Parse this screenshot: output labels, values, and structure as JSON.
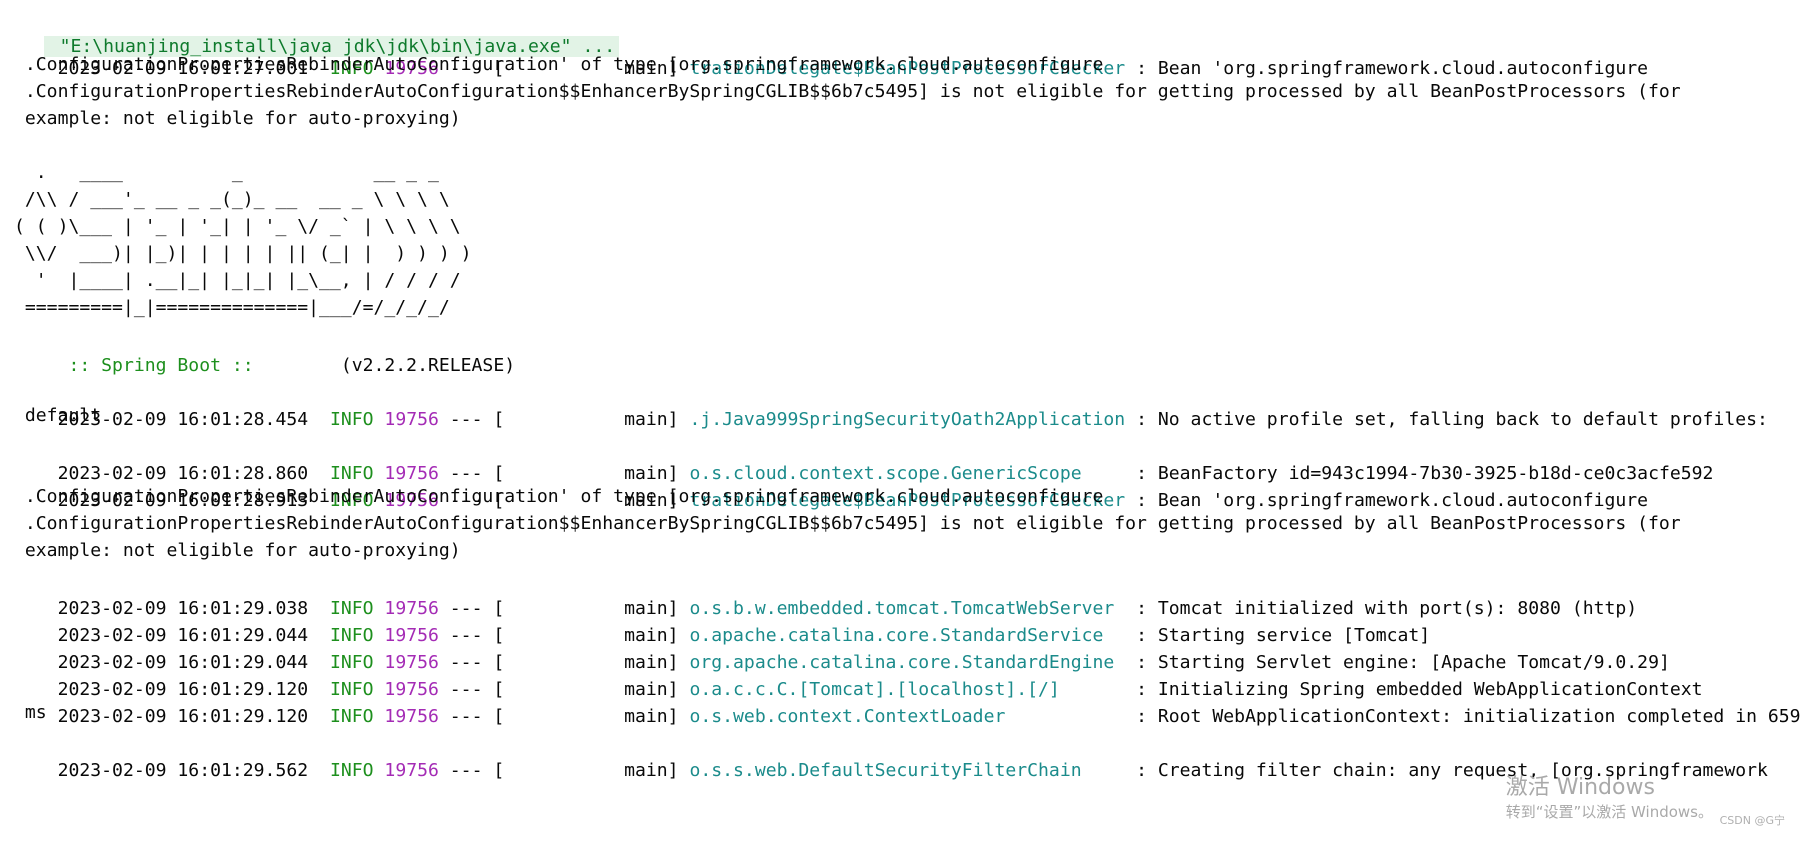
{
  "command": "\"E:\\huanjing_install\\java jdk\\jdk\\bin\\java.exe\" ...",
  "banner": [
    "  .   ____          _            __ _ _",
    " /\\\\ / ___'_ __ _ _(_)_ __  __ _ \\ \\ \\ \\",
    "( ( )\\___ | '_ | '_| | '_ \\/ _` | \\ \\ \\ \\",
    " \\\\/  ___)| |_)| | | | | || (_| |  ) ) ) )",
    "  '  |____| .__|_| |_|_| |_\\__, | / / / /",
    " =========|_|==============|___/=/_/_/_/"
  ],
  "boot_label": " :: Spring Boot :: ",
  "boot_version": "       (v2.2.2.RELEASE)",
  "logs_a": [
    {
      "ts": "2023-02-09 16:01:27.001",
      "level": "INFO",
      "pid": "19756",
      "thread": " --- [           main] ",
      "logger": "trationDelegate$BeanPostProcessorChecker",
      "msg": " : Bean 'org.springframework.cloud.autoconfigure"
    }
  ],
  "wrap_a": [
    " .ConfigurationPropertiesRebinderAutoConfiguration' of type [org.springframework.cloud.autoconfigure",
    " .ConfigurationPropertiesRebinderAutoConfiguration$$EnhancerBySpringCGLIB$$6b7c5495] is not eligible for getting processed by all BeanPostProcessors (for",
    " example: not eligible for auto-proxying)"
  ],
  "logs_b": [
    {
      "ts": "2023-02-09 16:01:28.454",
      "level": "INFO",
      "pid": "19756",
      "thread": " --- [           main] ",
      "logger": ".j.Java999SpringSecurityOath2Application",
      "msg": " : No active profile set, falling back to default profiles:"
    },
    {
      "ts": "2023-02-09 16:01:28.860",
      "level": "INFO",
      "pid": "19756",
      "thread": " --- [           main] ",
      "logger": "o.s.cloud.context.scope.GenericScope    ",
      "msg": " : BeanFactory id=943c1994-7b30-3925-b18d-ce0c3acfe592"
    },
    {
      "ts": "2023-02-09 16:01:28.913",
      "level": "INFO",
      "pid": "19756",
      "thread": " --- [           main] ",
      "logger": "trationDelegate$BeanPostProcessorChecker",
      "msg": " : Bean 'org.springframework.cloud.autoconfigure"
    }
  ],
  "wrap_b1": " default",
  "wrap_b2": [
    " .ConfigurationPropertiesRebinderAutoConfiguration' of type [org.springframework.cloud.autoconfigure",
    " .ConfigurationPropertiesRebinderAutoConfiguration$$EnhancerBySpringCGLIB$$6b7c5495] is not eligible for getting processed by all BeanPostProcessors (for",
    " example: not eligible for auto-proxying)"
  ],
  "logs_c": [
    {
      "ts": "2023-02-09 16:01:29.038",
      "level": "INFO",
      "pid": "19756",
      "thread": " --- [           main] ",
      "logger": "o.s.b.w.embedded.tomcat.TomcatWebServer ",
      "msg": " : Tomcat initialized with port(s): 8080 (http)"
    },
    {
      "ts": "2023-02-09 16:01:29.044",
      "level": "INFO",
      "pid": "19756",
      "thread": " --- [           main] ",
      "logger": "o.apache.catalina.core.StandardService  ",
      "msg": " : Starting service [Tomcat]"
    },
    {
      "ts": "2023-02-09 16:01:29.044",
      "level": "INFO",
      "pid": "19756",
      "thread": " --- [           main] ",
      "logger": "org.apache.catalina.core.StandardEngine ",
      "msg": " : Starting Servlet engine: [Apache Tomcat/9.0.29]"
    },
    {
      "ts": "2023-02-09 16:01:29.120",
      "level": "INFO",
      "pid": "19756",
      "thread": " --- [           main] ",
      "logger": "o.a.c.c.C.[Tomcat].[localhost].[/]      ",
      "msg": " : Initializing Spring embedded WebApplicationContext"
    },
    {
      "ts": "2023-02-09 16:01:29.120",
      "level": "INFO",
      "pid": "19756",
      "thread": " --- [           main] ",
      "logger": "o.s.web.context.ContextLoader           ",
      "msg": " : Root WebApplicationContext: initialization completed in 659"
    }
  ],
  "wrap_c": " ms",
  "partial_line": {
    "ts": "2023-02-09 16:01:29.562",
    "level": "INFO",
    "pid": "19756",
    "thread": " --- [           main] ",
    "logger": "o.s.s.web.DefaultSecurityFilterChain    ",
    "msg": " : Creating filter chain: any request, [org.springframework"
  },
  "watermark": {
    "title": "激活 Windows",
    "subtitle": "转到“设置”以激活 Windows。",
    "credit": "CSDN @G宁"
  }
}
